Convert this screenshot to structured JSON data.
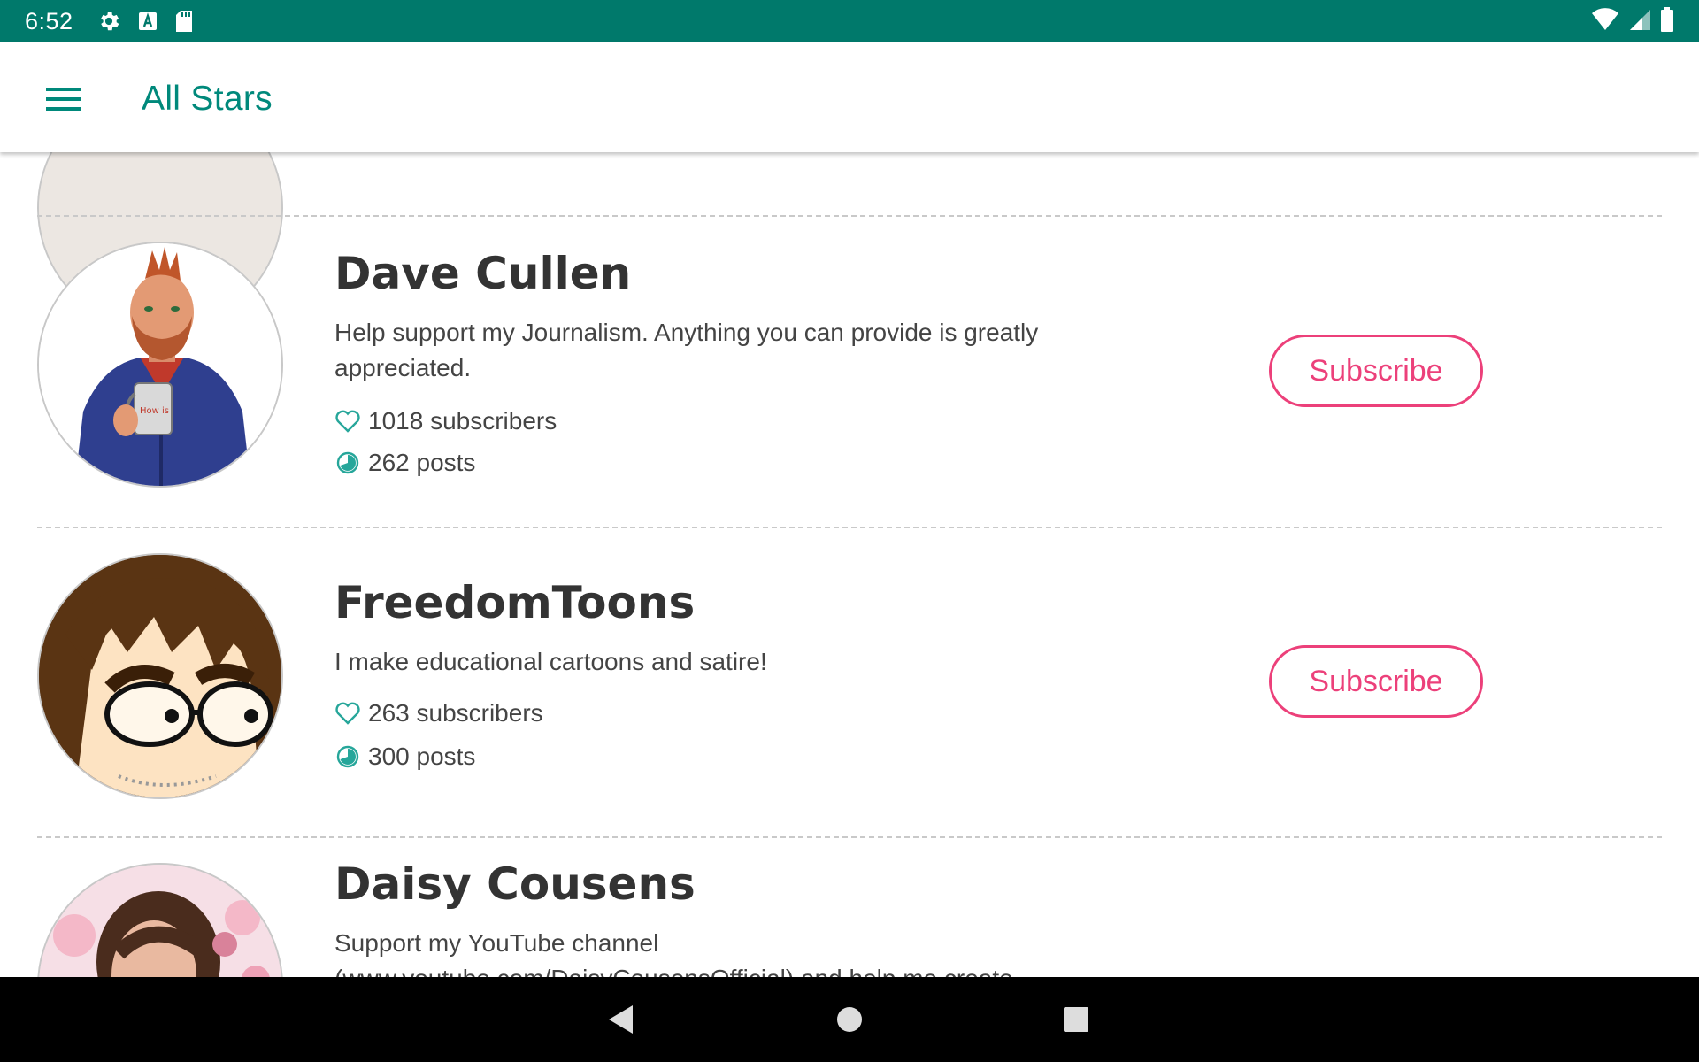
{
  "status_bar": {
    "time": "6:52",
    "icons": [
      "gear-icon",
      "a-badge-icon",
      "sd-card-icon"
    ],
    "right_icons": [
      "wifi-icon",
      "cell-signal-icon",
      "battery-icon"
    ]
  },
  "app_bar": {
    "title": "All Stars",
    "menu_icon": "hamburger-menu-icon"
  },
  "colors": {
    "status_bar": "#00796b",
    "accent": "#00897b",
    "subscribe": "#ec407a",
    "text": "#333333"
  },
  "stars": [
    {
      "name": "Dave Cullen",
      "description": "Help support my Journalism. Anything you can provide is greatly appreciated.",
      "subscribers": "1018 subscribers",
      "posts": "262 posts",
      "button": "Subscribe"
    },
    {
      "name": "FreedomToons",
      "description": "I make educational cartoons and satire!",
      "subscribers": "263 subscribers",
      "posts": "300 posts",
      "button": "Subscribe"
    },
    {
      "name": "Daisy Cousens",
      "description": "Support my YouTube channel (www.youtube.com/DaisyCousensOfficial) and help me create"
    }
  ],
  "nav_bar": {
    "icons": [
      "back-icon",
      "home-icon",
      "recents-icon"
    ]
  }
}
